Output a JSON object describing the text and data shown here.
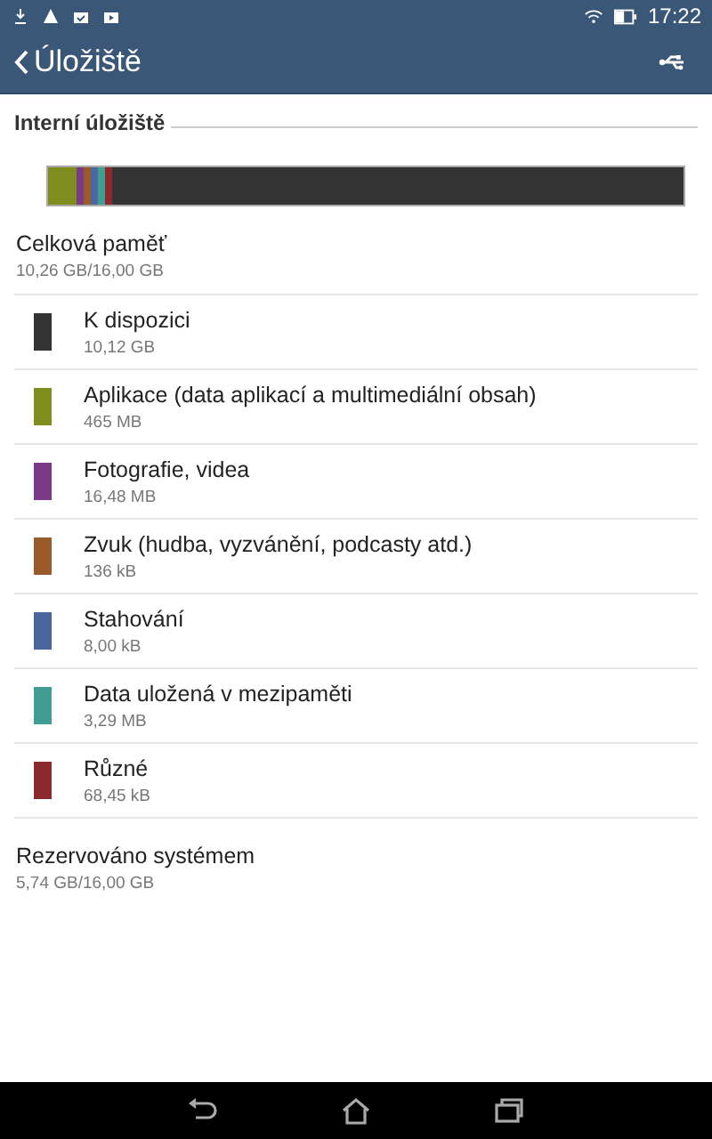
{
  "status_bar": {
    "time": "17:22"
  },
  "app_bar": {
    "title": "Úložiště"
  },
  "section": {
    "title": "Interní úložiště"
  },
  "total": {
    "label": "Celková paměť",
    "value": "10,26 GB/16,00 GB"
  },
  "categories": [
    {
      "kind": "free",
      "label": "K dispozici",
      "value": "10,12 GB",
      "color": "#333333"
    },
    {
      "kind": "used",
      "label": "Aplikace (data aplikací a multimediální obsah)",
      "value": "465 MB",
      "color": "#7f8c1e"
    },
    {
      "kind": "used",
      "label": "Fotografie, videa",
      "value": "16,48 MB",
      "color": "#7b3a86"
    },
    {
      "kind": "used",
      "label": "Zvuk (hudba, vyzvánění, podcasty atd.)",
      "value": "136 kB",
      "color": "#9a5a2c"
    },
    {
      "kind": "used",
      "label": "Stahování",
      "value": "8,00 kB",
      "color": "#4a68a0"
    },
    {
      "kind": "used",
      "label": "Data uložená v mezipaměti",
      "value": "3,29 MB",
      "color": "#3f9d93"
    },
    {
      "kind": "used",
      "label": "Různé",
      "value": "68,45 kB",
      "color": "#8a2a2e"
    }
  ],
  "reserved": {
    "label": "Rezervováno systémem",
    "value": "5,74 GB/16,00 GB"
  }
}
